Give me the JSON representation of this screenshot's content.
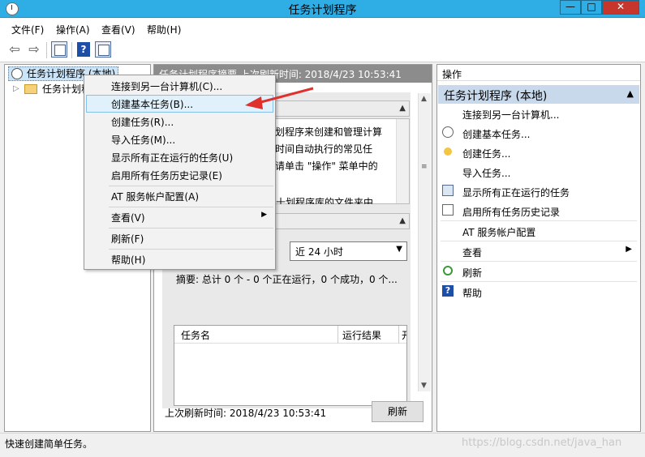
{
  "window": {
    "title": "任务计划程序",
    "btn_min": "—",
    "btn_max": "□",
    "btn_close": "✕"
  },
  "menu": [
    "文件(F)",
    "操作(A)",
    "查看(V)",
    "帮助(H)"
  ],
  "tree": {
    "root": "任务计划程序 (本地)",
    "child": "任务计划程"
  },
  "center": {
    "header": "任务计划程序摘要 上次刷新时间: 2018/4/23 10:53:41",
    "overview_lines": [
      "划程序来创建和管理计算",
      "时间自动执行的常见任",
      "请单击 \"操作\" 菜单中的"
    ],
    "overview_cut": "十划程序库的文件夹中",
    "time_select": "近 24 小时",
    "summary": "摘要: 总计 0 个 - 0 个正在运行，0 个成功，0 个...",
    "grid_cols": [
      "任务名",
      "运行结果",
      "开"
    ],
    "last_refresh": "上次刷新时间: 2018/4/23 10:53:41",
    "refresh_btn": "刷新"
  },
  "actions": {
    "title": "操作",
    "section": "任务计划程序 (本地)",
    "items": [
      {
        "label": "连接到另一台计算机..."
      },
      {
        "label": "创建基本任务..."
      },
      {
        "label": "创建任务..."
      },
      {
        "label": "导入任务..."
      },
      {
        "label": "显示所有正在运行的任务"
      },
      {
        "label": "启用所有任务历史记录"
      },
      {
        "label": "AT 服务帐户配置"
      },
      {
        "label": "查看"
      },
      {
        "label": "刷新"
      },
      {
        "label": "帮助"
      }
    ]
  },
  "context_menu": [
    "连接到另一台计算机(C)...",
    "创建基本任务(B)...",
    "创建任务(R)...",
    "导入任务(M)...",
    "显示所有正在运行的任务(U)",
    "启用所有任务历史记录(E)",
    "AT 服务帐户配置(A)",
    "查看(V)",
    "刷新(F)",
    "帮助(H)"
  ],
  "status": {
    "text": "快速创建简单任务。",
    "watermark": "https://blog.csdn.net/java_han"
  },
  "colors": {
    "titlebar": "#2faee6",
    "close": "#c7362c",
    "highlight": "#e1f1fb",
    "actions_section": "#c9d9ec",
    "arrow": "#e0302b"
  }
}
